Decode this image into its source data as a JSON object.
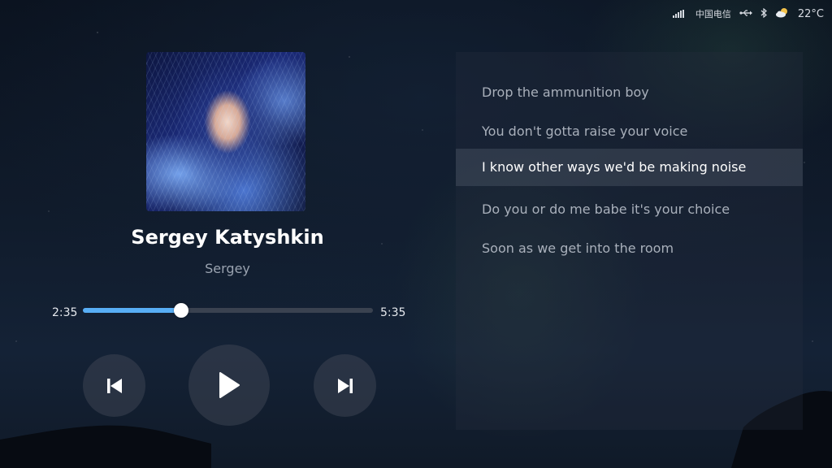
{
  "status_bar": {
    "carrier": "中国电信",
    "temperature": "22°C",
    "icons": [
      "signal-icon",
      "usb-icon",
      "bluetooth-icon",
      "weather-cloud-sun-icon"
    ]
  },
  "player": {
    "title": "Sergey Katyshkin",
    "artist": "Sergey",
    "time_current": "2:35",
    "time_total": "5:35",
    "progress_fraction": 0.34,
    "accent_color": "#58aef5",
    "controls": {
      "prev_icon": "skip-previous-icon",
      "play_icon": "play-icon",
      "next_icon": "skip-next-icon"
    }
  },
  "lyrics": {
    "active_index": 2,
    "lines": [
      "Drop the ammunition boy",
      "You don't gotta raise your voice",
      "I know other ways we'd be making noise",
      "Do you or do me babe it's your choice",
      "Soon as we get into the room"
    ]
  }
}
